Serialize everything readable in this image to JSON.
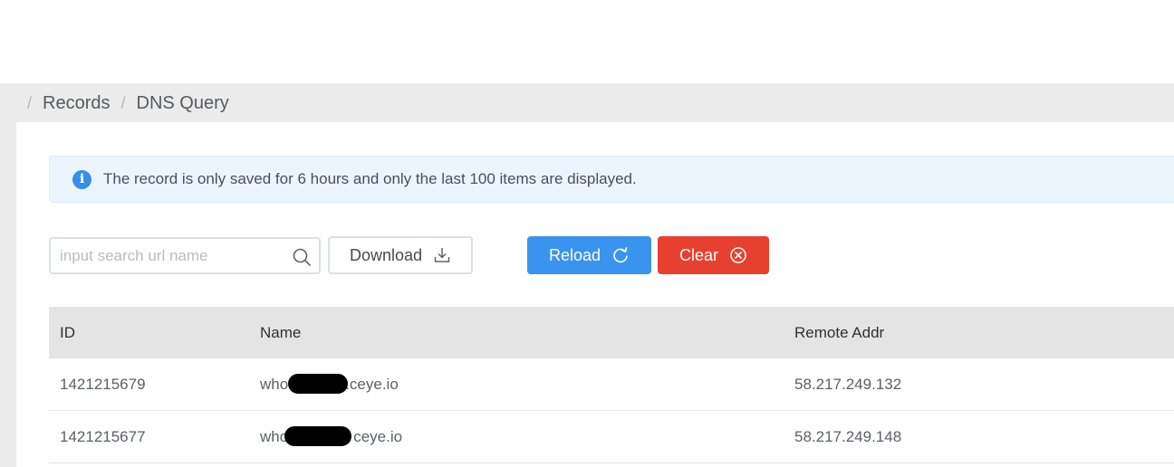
{
  "breadcrumb": {
    "items": [
      "Records",
      "DNS Query"
    ]
  },
  "alert": {
    "icon": "info-icon",
    "message": "The record is only saved for 6 hours and only the last 100 items are displayed."
  },
  "toolbar": {
    "search_placeholder": "input search url name",
    "download_label": "Download",
    "reload_label": "Reload",
    "clear_label": "Clear"
  },
  "colors": {
    "reload": "#3a93ee",
    "clear": "#e8402e",
    "alert_bg": "#ecf5ff",
    "header_bg": "#e4e4e4"
  },
  "table": {
    "headers": [
      "ID",
      "Name",
      "Remote Addr"
    ],
    "rows": [
      {
        "id": "1421215679",
        "name_prefix": "who",
        "name_suffix": ".ceye.io",
        "addr": "58.217.249.132"
      },
      {
        "id": "1421215677",
        "name_prefix": "who",
        "name_suffix": "ceye.io",
        "addr": "58.217.249.148"
      }
    ]
  }
}
